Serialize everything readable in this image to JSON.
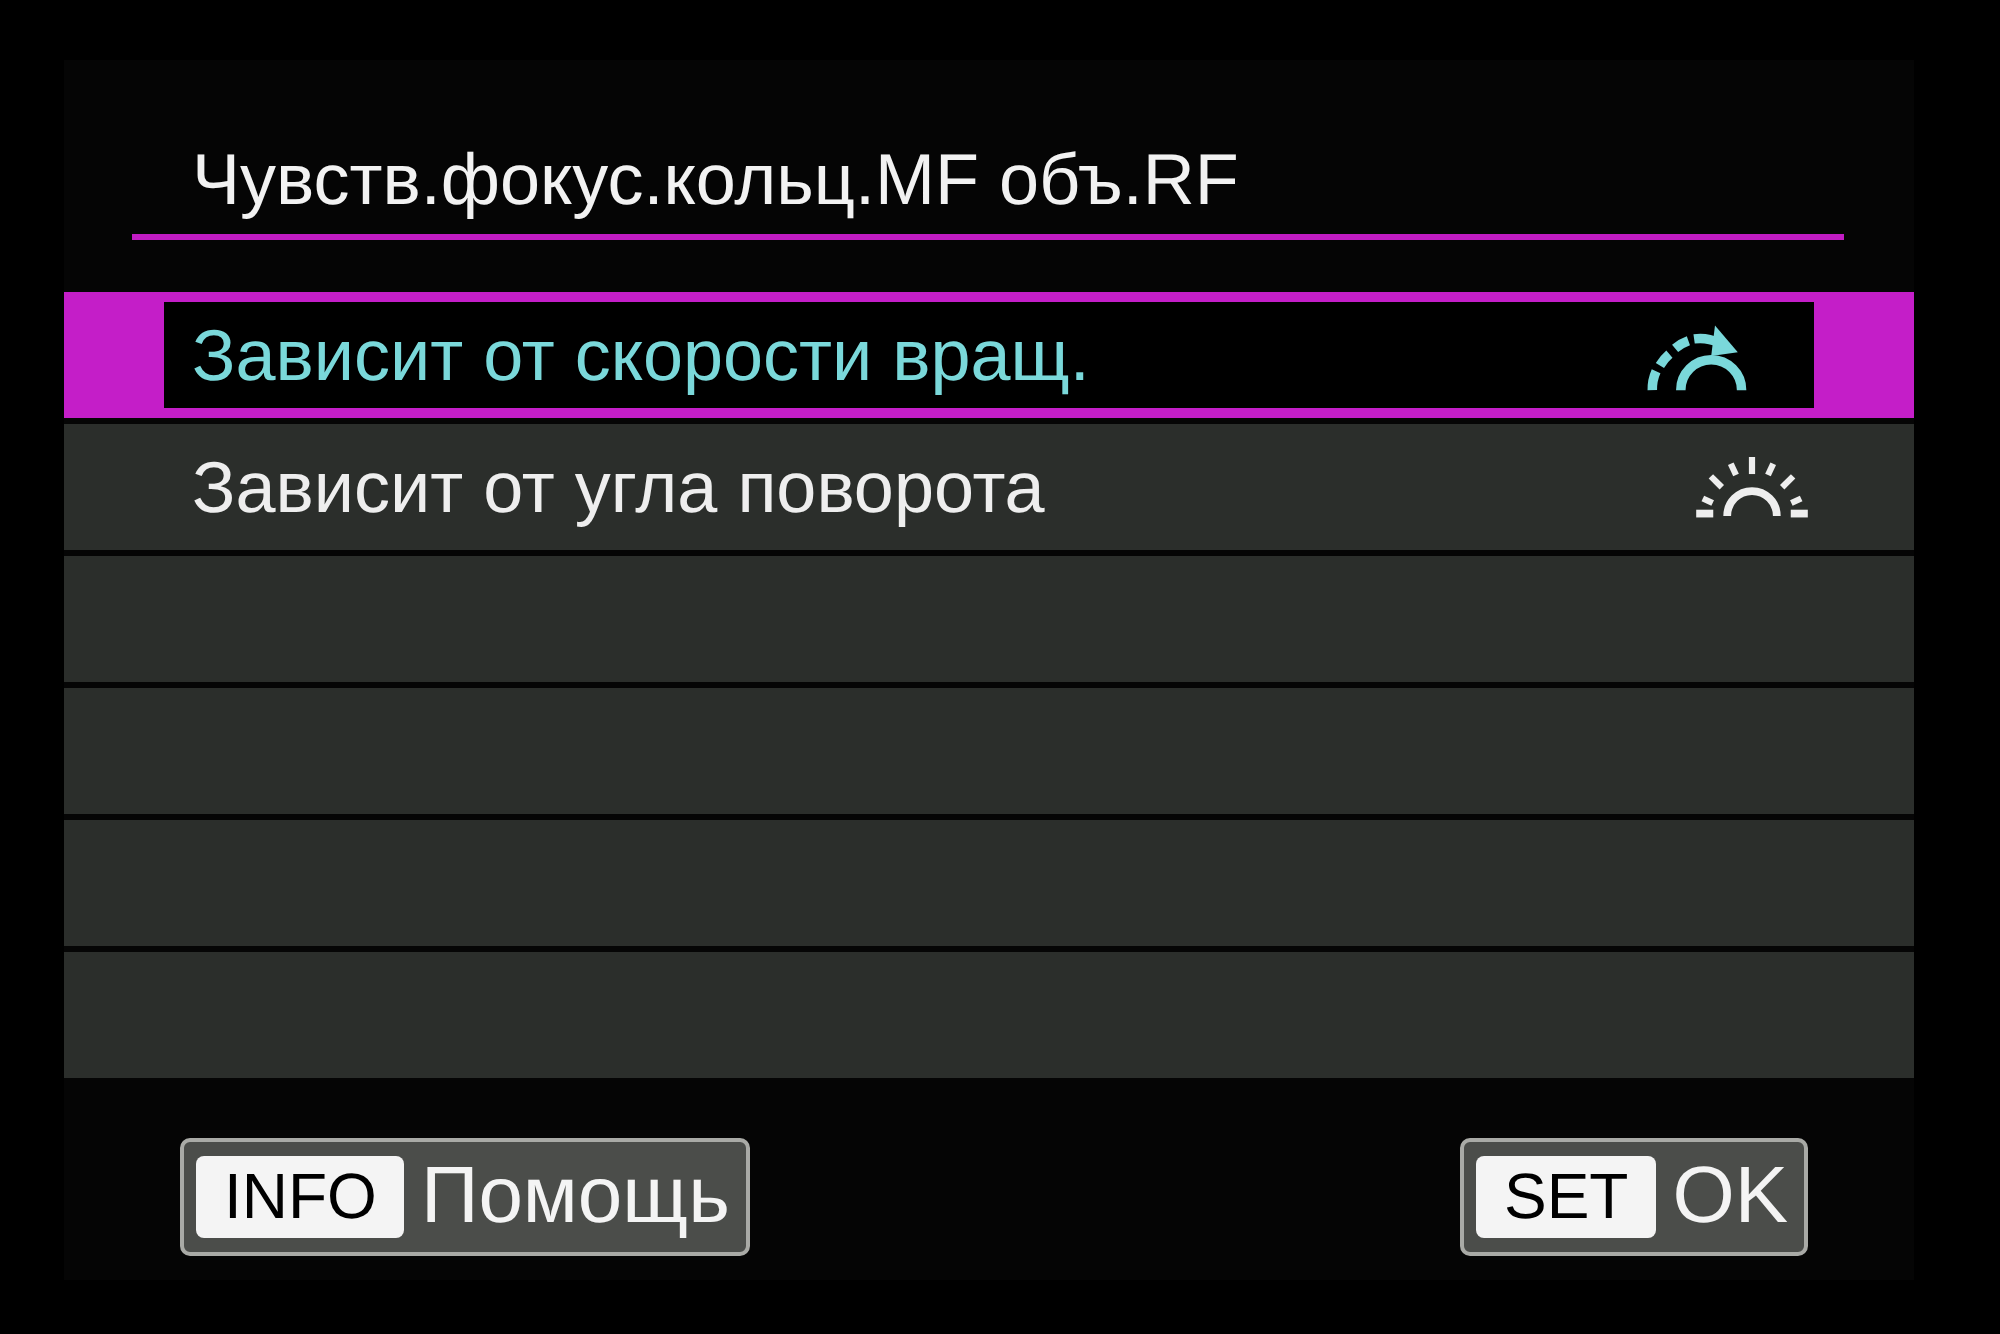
{
  "title": "Чувств.фокус.кольц.MF объ.RF",
  "options": [
    {
      "kind": "speed",
      "label": "Зависит от скорости вращ.",
      "selected": true
    },
    {
      "kind": "angle",
      "label": "Зависит от угла поворота",
      "selected": false
    },
    {
      "kind": "empty",
      "selected": false
    },
    {
      "kind": "empty",
      "selected": false
    },
    {
      "kind": "empty",
      "selected": false
    },
    {
      "kind": "empty",
      "selected": false
    }
  ],
  "buttons": [
    {
      "key": "INFO",
      "label": "Помощь"
    },
    {
      "key": "SET",
      "label": "OK"
    }
  ]
}
